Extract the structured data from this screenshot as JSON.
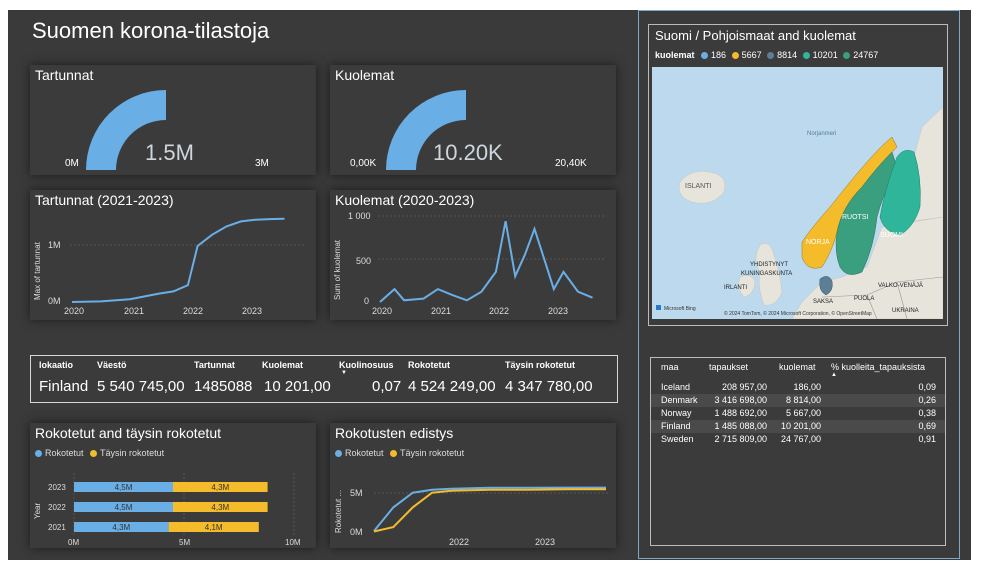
{
  "title": "Suomen korona-tilastoja",
  "gauges": [
    {
      "title": "Tartunnat",
      "value": "1.5M",
      "min": "0M",
      "max": "3M",
      "fraction": 0.5
    },
    {
      "title": "Kuolemat",
      "value": "10.20K",
      "min": "0,00K",
      "max": "20,40K",
      "fraction": 0.5
    }
  ],
  "colors": {
    "blue": "#6aaee6",
    "yellow": "#f4bb2a",
    "teal": "#2fb69a",
    "green": "#3a9f7e",
    "accent": "#7fa6c8"
  },
  "line1": {
    "title": "Tartunnat (2021-2023)",
    "ylabel": "Max of tartunnat",
    "yticks": [
      "1M",
      "0M"
    ],
    "xticks": [
      "2020",
      "2021",
      "2022",
      "2023"
    ]
  },
  "line2": {
    "title": "Kuolemat (2020-2023)",
    "ylabel": "Sum of kuolemat",
    "yticks": [
      "1 000",
      "500",
      "0"
    ],
    "xticks": [
      "2020",
      "2021",
      "2022",
      "2023"
    ]
  },
  "summary": {
    "headers": [
      "lokaatio",
      "Väestö",
      "Tartunnat",
      "Kuolemat",
      "Kuolinosuus",
      "Rokotetut",
      "Täysin rokotetut"
    ],
    "values": [
      "Finland",
      "5 540 745,00",
      "1485088",
      "10 201,00",
      "0,07",
      "4 524 249,00",
      "4 347 780,00"
    ]
  },
  "bar_chart": {
    "title": "Rokotetut and täysin rokotetut",
    "legend": [
      "Rokotetut",
      "Täysin rokotetut"
    ],
    "ylabel": "Year",
    "xticks": [
      "0M",
      "5M",
      "10M"
    ]
  },
  "progress_chart": {
    "title": "Rokotusten edistys",
    "legend": [
      "Rokotetut",
      "Täysin rokotetut"
    ],
    "ylabel": "Rokotetut ...",
    "yticks": [
      "5M",
      "0M"
    ],
    "xticks": [
      "2022",
      "2023"
    ]
  },
  "map": {
    "title": "Suomi / Pohjoismaat and kuolemat",
    "legend_label": "kuolemat",
    "legend": [
      {
        "label": "186",
        "color": "#6aaee6"
      },
      {
        "label": "5667",
        "color": "#f4bb2a"
      },
      {
        "label": "8814",
        "color": "#5d7f95"
      },
      {
        "label": "10201",
        "color": "#2fb69a"
      },
      {
        "label": "24767",
        "color": "#3a9f7e"
      }
    ],
    "labels": {
      "norjanmeri": "Norjanmeri",
      "islanti": "ISLANTI",
      "ruotsi": "RUOTSI",
      "norja": "NORJA",
      "suomi": "SUOMI",
      "yk1": "YHDISTYNYT",
      "yk2": "KUNINGASKUNTA",
      "irlanti": "IRLANTI",
      "saksa": "SAKSA",
      "puola": "PUOLA",
      "valko": "VALKO-VENÄJÄ",
      "ukraina": "UKRAINA"
    },
    "bing": "Microsoft Bing",
    "attribution": "© 2024 TomTom, © 2024 Microsoft Corporation, © OpenStreetMap"
  },
  "side_table": {
    "headers": [
      "maa",
      "tapaukset",
      "kuolemat",
      "% kuolleita_tapauksista"
    ],
    "rows": [
      [
        "Iceland",
        "208 957,00",
        "186,00",
        "0,09"
      ],
      [
        "Denmark",
        "3 416 698,00",
        "8 814,00",
        "0,26"
      ],
      [
        "Norway",
        "1 488 692,00",
        "5 667,00",
        "0,38"
      ],
      [
        "Finland",
        "1 485 088,00",
        "10 201,00",
        "0,69"
      ],
      [
        "Sweden",
        "2 715 809,00",
        "24 767,00",
        "0,91"
      ]
    ]
  },
  "chart_data": [
    {
      "type": "line",
      "title": "Tartunnat (2021-2023)",
      "ylabel": "Max of tartunnat",
      "x": [
        "2020-01",
        "2020-07",
        "2021-01",
        "2021-07",
        "2021-10",
        "2022-01",
        "2022-03",
        "2022-06",
        "2022-09",
        "2022-12",
        "2023-03",
        "2023-06",
        "2023-09"
      ],
      "y": [
        0,
        10000,
        50000,
        150000,
        190000,
        300000,
        1000000,
        1200000,
        1350000,
        1440000,
        1470000,
        1480000,
        1485088
      ],
      "ylim": [
        0,
        1500000
      ]
    },
    {
      "type": "line",
      "title": "Kuolemat (2020-2023)",
      "ylabel": "Sum of kuolemat",
      "x": [
        "2020-01",
        "2020-04",
        "2020-06",
        "2020-10",
        "2021-01",
        "2021-04",
        "2021-07",
        "2021-10",
        "2022-01",
        "2022-03",
        "2022-05",
        "2022-07",
        "2022-09",
        "2022-11",
        "2023-01",
        "2023-03",
        "2023-06",
        "2023-09"
      ],
      "y": [
        0,
        150,
        20,
        40,
        150,
        80,
        20,
        120,
        350,
        940,
        300,
        550,
        850,
        500,
        150,
        350,
        120,
        50
      ],
      "ylim": [
        0,
        1000
      ]
    },
    {
      "type": "bar",
      "title": "Rokotetut and täysin rokotetut",
      "categories": [
        "2023",
        "2022",
        "2021"
      ],
      "series": [
        {
          "name": "Rokotetut",
          "values": [
            4.5,
            4.5,
            4.3
          ],
          "labels": [
            "4,5M",
            "4,5M",
            "4,3M"
          ]
        },
        {
          "name": "Täysin rokotetut",
          "values": [
            4.3,
            4.3,
            4.1
          ],
          "labels": [
            "4,3M",
            "4,3M",
            "4,1M"
          ]
        }
      ],
      "ylabel": "Year",
      "xlim": [
        0,
        10
      ]
    },
    {
      "type": "line",
      "title": "Rokotusten edistys",
      "x": [
        "2021-01",
        "2021-04",
        "2021-07",
        "2021-10",
        "2022-01",
        "2022-07",
        "2023-01",
        "2023-07",
        "2024-01"
      ],
      "series": [
        {
          "name": "Rokotetut",
          "values": [
            0.1,
            2.5,
            4.0,
            4.3,
            4.4,
            4.5,
            4.5,
            4.52,
            4.52
          ]
        },
        {
          "name": "Täysin rokotetut",
          "values": [
            0.05,
            0.5,
            2.5,
            4.0,
            4.2,
            4.3,
            4.3,
            4.35,
            4.35
          ]
        }
      ],
      "ylim": [
        0,
        6
      ]
    }
  ]
}
